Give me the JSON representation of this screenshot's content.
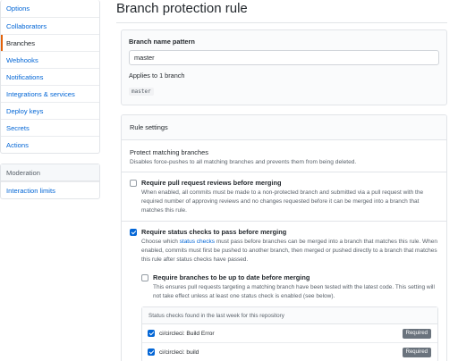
{
  "sidebar": {
    "items": [
      {
        "label": "Options"
      },
      {
        "label": "Collaborators"
      },
      {
        "label": "Branches"
      },
      {
        "label": "Webhooks"
      },
      {
        "label": "Notifications"
      },
      {
        "label": "Integrations & services"
      },
      {
        "label": "Deploy keys"
      },
      {
        "label": "Secrets"
      },
      {
        "label": "Actions"
      }
    ],
    "moderation_heading": "Moderation",
    "moderation_items": [
      {
        "label": "Interaction limits"
      }
    ]
  },
  "page": {
    "title": "Branch protection rule"
  },
  "pattern": {
    "label": "Branch name pattern",
    "value": "master",
    "applies_text": "Applies to 1 branch",
    "branch_tag": "master"
  },
  "rule_settings": {
    "header": "Rule settings",
    "protect_title": "Protect matching branches",
    "protect_desc": "Disables force-pushes to all matching branches and prevents them from being deleted.",
    "rules": [
      {
        "title": "Require pull request reviews before merging",
        "desc": "When enabled, all commits must be made to a non-protected branch and submitted via a pull request with the required number of approving reviews and no changes requested before it can be merged into a branch that matches this rule.",
        "checked": false
      },
      {
        "title": "Require status checks to pass before merging",
        "desc_pre": "Choose which ",
        "desc_link": "status checks",
        "desc_post": " must pass before branches can be merged into a branch that matches this rule. When enabled, commits must first be pushed to another branch, then merged or pushed directly to a branch that matches this rule after status checks have passed.",
        "checked": true
      }
    ],
    "subrule": {
      "title": "Require branches to be up to date before merging",
      "desc": "This ensures pull requests targeting a matching branch have been tested with the latest code. This setting will not take effect unless at least one status check is enabled (see below).",
      "checked": false
    },
    "checks_header": "Status checks found in the last week for this repository",
    "checks": [
      {
        "name": "ci/circleci: Build Error",
        "badge": "Required",
        "checked": true
      },
      {
        "name": "ci/circleci: build",
        "badge": "Required",
        "checked": true
      }
    ]
  }
}
